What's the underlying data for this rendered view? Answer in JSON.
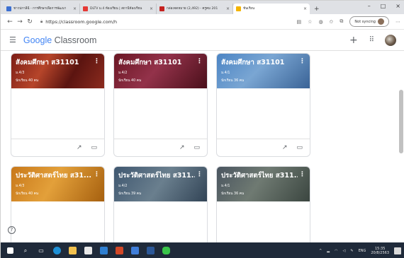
{
  "browser": {
    "tabs": [
      {
        "title": "ชาวปกาลีฉี้ - การศึกษาเพื่อการพัฒนา",
        "color": "#3b6fd1"
      },
      {
        "title": "DLTV ม.4 ห้องเรียน | สถานีห้องเรียน",
        "color": "#e53935"
      },
      {
        "title": "กล่องจดหมาย (2,492) - ครูคม 201",
        "color": "#c5221f"
      },
      {
        "title": "ชั้นเรียน",
        "color": "#f4b400",
        "active": true
      }
    ],
    "url": "https://classroom.google.com/h",
    "sync_label": "Not syncing",
    "window_controls": [
      "–",
      "□",
      "×"
    ]
  },
  "app": {
    "logo_google": "Google",
    "logo_classroom": "Classroom"
  },
  "classes": [
    {
      "title": "สังคมศึกษา ส31101",
      "section": "ม.4/3",
      "students": "นักเรียน 40 คน",
      "banner": "red"
    },
    {
      "title": "สังคมศึกษา ส31101",
      "section": "ม.4/2",
      "students": "นักเรียน 40 คน",
      "banner": "maroon"
    },
    {
      "title": "สังคมศึกษา ส31101",
      "section": "ม.4/1",
      "students": "นักเรียน 36 คน",
      "banner": "blue"
    },
    {
      "title": "ประวัติศาสตร์ไทย ส31...",
      "section": "ม.4/3",
      "students": "นักเรียน 40 คน",
      "banner": "orange"
    },
    {
      "title": "ประวัติศาสตร์ไทย ส311...",
      "section": "ม.4/2",
      "students": "นักเรียน 39 คน",
      "banner": "slate"
    },
    {
      "title": "ประวัติศาสตร์ไทย ส311...",
      "section": "ม.4/1",
      "students": "นักเรียน 36 คน",
      "banner": "ruins"
    }
  ],
  "taskbar": {
    "language": "ENG",
    "time": "15:35",
    "date": "20/8/2563"
  }
}
